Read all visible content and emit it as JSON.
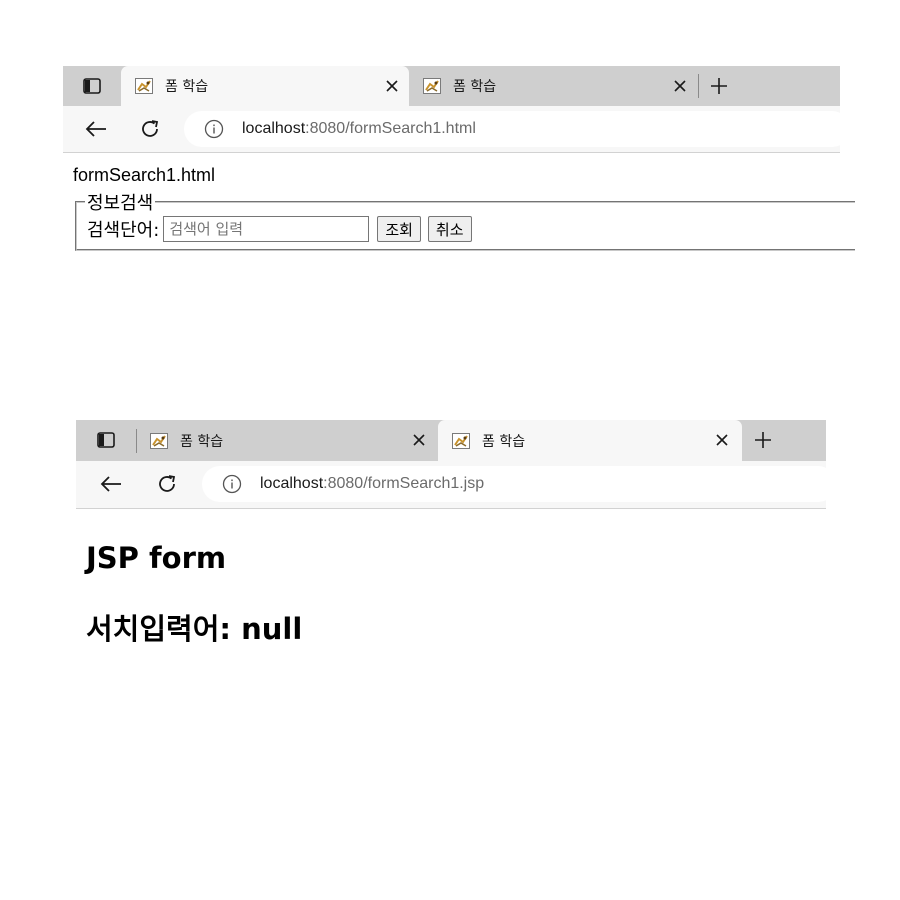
{
  "window_top": {
    "tabs": [
      {
        "title": "폼 학습",
        "active": true
      },
      {
        "title": "폼 학습",
        "active": false
      }
    ],
    "address": {
      "host": "localhost",
      "path": ":8080/formSearch1.html"
    },
    "page": {
      "filename_text": "formSearch1.html",
      "fieldset_legend": "정보검색",
      "search_label": "검색단어:",
      "search_placeholder": "검색어 입력",
      "search_value": "",
      "submit_label": "조회",
      "reset_label": "취소"
    }
  },
  "window_bottom": {
    "tabs": [
      {
        "title": "폼 학습",
        "active": false
      },
      {
        "title": "폼 학습",
        "active": true
      }
    ],
    "address": {
      "host": "localhost",
      "path": ":8080/formSearch1.jsp"
    },
    "page": {
      "heading": "JSP form",
      "result_text": "서치입력어: null"
    }
  },
  "icons": {
    "tab_actions": "tab-actions-icon",
    "favicon": "tomcat-favicon",
    "close": "close-icon",
    "new_tab": "plus-icon",
    "back": "back-arrow-icon",
    "refresh": "refresh-icon",
    "info": "info-icon"
  },
  "colors": {
    "tabstrip_bg": "#cfcfcf",
    "active_tab_bg": "#f7f7f7",
    "url_path": "#6b6b6b"
  }
}
